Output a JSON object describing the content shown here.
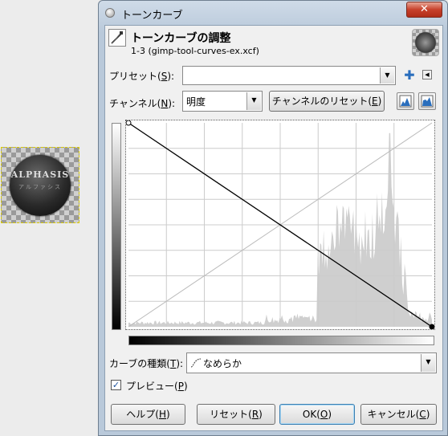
{
  "canvas": {
    "thumbnail_text": "ALPHASIS",
    "thumbnail_subtext": "アルファシス"
  },
  "window": {
    "title": "トーンカーブ",
    "close_label": "✕"
  },
  "header": {
    "title": "トーンカーブの調整",
    "subtitle": "1-3 (gimp-tool-curves-ex.xcf)"
  },
  "preset": {
    "label": "プリセット(",
    "mnemonic": "S",
    "label_end": "):",
    "value": ""
  },
  "channel": {
    "label": "チャンネル(",
    "mnemonic": "N",
    "label_end": "):",
    "value": "明度",
    "reset_label": "チャンネルのリセット(",
    "reset_mnemonic": "E",
    "reset_end": ")"
  },
  "curve_type": {
    "label": "カーブの種類(",
    "mnemonic": "T",
    "label_end": "):",
    "value": "なめらか"
  },
  "preview": {
    "label": "プレビュー(",
    "mnemonic": "P",
    "label_end": ")",
    "checked": true
  },
  "buttons": {
    "help": "ヘルプ(",
    "help_m": "H",
    "reset": "リセット(",
    "reset_m": "R",
    "ok": "OK(",
    "ok_m": "O",
    "cancel": "キャンセル(",
    "cancel_m": "C",
    "close_paren": ")"
  },
  "curve": {
    "points": [
      [
        0,
        255
      ],
      [
        255,
        0
      ]
    ]
  },
  "colors": {
    "accent": "#2a6ebd",
    "curve": "#000000",
    "histogram": "#cfcfcf",
    "grid": "#cccccc"
  }
}
